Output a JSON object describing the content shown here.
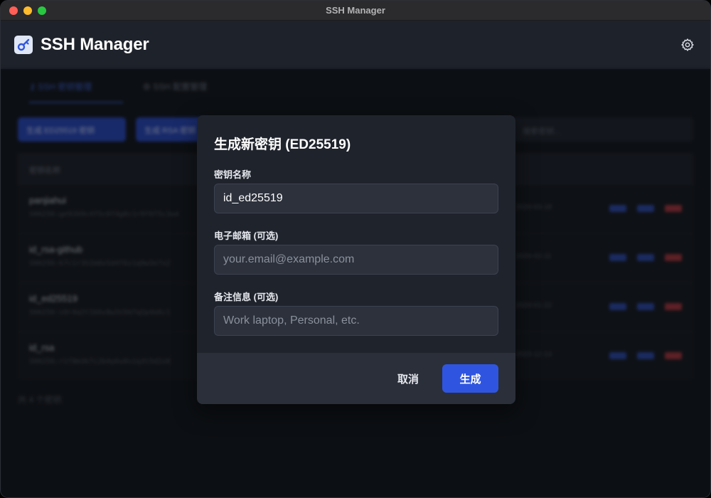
{
  "window": {
    "title": "SSH Manager"
  },
  "app": {
    "name": "SSH Manager",
    "logo_icon": "key-icon",
    "settings_icon": "gear-icon"
  },
  "background": {
    "tabs": [
      {
        "label": "SSH 密钥管理",
        "icon": "key-icon"
      },
      {
        "label": "SSH 配置管理",
        "icon": "gear-icon"
      }
    ],
    "buttons": [
      "生成 ED25519 密钥",
      "生成 RSA 密钥"
    ],
    "search_placeholder": "搜索密钥...",
    "table_header": "密钥名称",
    "rows": [
      {
        "name": "panjiahui",
        "fingerprint": "SHA256:ge92b9c4f5c0f4g0c1r9f0f5c3a4",
        "time": "2024-03-18"
      },
      {
        "name": "id_rsa-github",
        "fingerprint": "SHA256:k7c1r3h2m8s5d4f6z1q9w3e7x2",
        "time": "2024-02-11"
      },
      {
        "name": "id_ed25519",
        "fingerprint": "SHA256:s9r4a2t1b6v8w3n5m7q2p4e6c1",
        "time": "2024-01-22"
      },
      {
        "name": "id_rsa",
        "fingerprint": "SHA256:r1f8m3k7c2b4y6u9v1q3t5d2z8",
        "time": "2023-12-14"
      }
    ],
    "footer": "共 4 个密钥"
  },
  "modal": {
    "title": "生成新密钥 (ED25519)",
    "fields": [
      {
        "label": "密钥名称",
        "value": "id_ed25519",
        "placeholder": ""
      },
      {
        "label": "电子邮箱 (可选)",
        "value": "",
        "placeholder": "your.email@example.com"
      },
      {
        "label": "备注信息 (可选)",
        "value": "",
        "placeholder": "Work laptop, Personal, etc."
      }
    ],
    "cancel_label": "取消",
    "generate_label": "生成"
  },
  "colors": {
    "accent": "#2f55e0",
    "danger": "#a3343c",
    "background": "#171a21"
  }
}
